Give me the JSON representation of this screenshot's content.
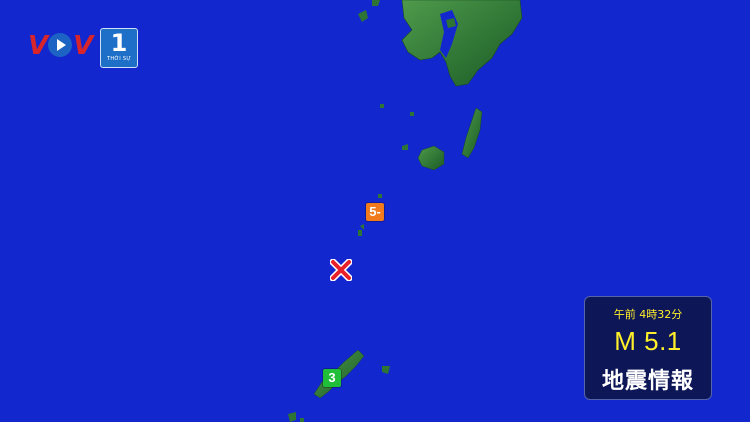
{
  "logo": {
    "brand": "VOV",
    "channel": "1",
    "channel_sub": "THỜI SỰ"
  },
  "map": {
    "intensity_markers": [
      {
        "label": "5-",
        "color": "#f07a1c"
      },
      {
        "label": "3",
        "color": "#1fbf3a"
      }
    ],
    "epicenter_icon": "cross-icon"
  },
  "info_panel": {
    "time": "午前 4時32分",
    "magnitude": "M 5.1",
    "title": "地震情報"
  },
  "colors": {
    "sea": "#1327cf",
    "land": "#2f7a37",
    "panel_bg": "#0d1656",
    "highlight": "#ffee2a"
  }
}
